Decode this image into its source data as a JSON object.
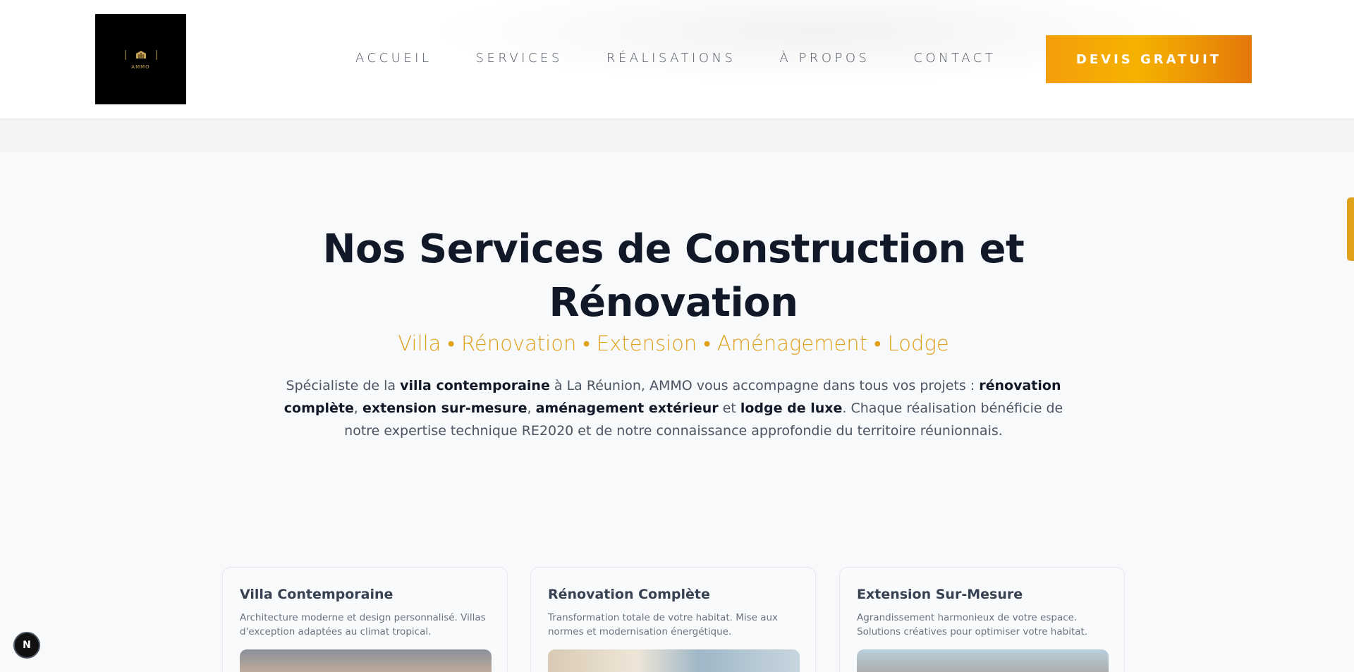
{
  "header": {
    "logo_text": "AMMO",
    "nav": [
      "ACCUEIL",
      "SERVICES",
      "RÉALISATIONS",
      "À PROPOS",
      "CONTACT"
    ],
    "cta_label": "DEVIS GRATUIT"
  },
  "hero": {
    "title_line1": "Nos Services de Construction et",
    "title_line2": "Rénovation",
    "subtitle": "Villa • Rénovation • Extension • Aménagement • Lodge",
    "intro": {
      "t1": "Spécialiste de la ",
      "b1": "villa contemporaine",
      "t2": " à La Réunion, AMMO vous accompagne dans tous vos projets : ",
      "b2": "rénovation complète",
      "t3": ", ",
      "b3": "extension sur-mesure",
      "t4": ", ",
      "b4": "aménagement extérieur",
      "t5": " et ",
      "b5": "lodge de luxe",
      "t6": ". Chaque réalisation bénéficie de notre expertise technique RE2020 et de notre connaissance approfondie du territoire réunionnais."
    }
  },
  "cards": [
    {
      "title": "Villa Contemporaine",
      "desc": "Architecture moderne et design personnalisé. Villas d'exception adaptées au climat tropical."
    },
    {
      "title": "Rénovation Complète",
      "desc": "Transformation totale de votre habitat. Mise aux normes et modernisation énergétique."
    },
    {
      "title": "Extension Sur-Mesure",
      "desc": "Agrandissement harmonieux de votre espace. Solutions créatives pour optimiser votre habitat."
    }
  ],
  "badge": "N",
  "colors": {
    "accent": "#e0a11b",
    "cta_start": "#f59e0b",
    "cta_end": "#e4780a",
    "heading": "#111827"
  }
}
